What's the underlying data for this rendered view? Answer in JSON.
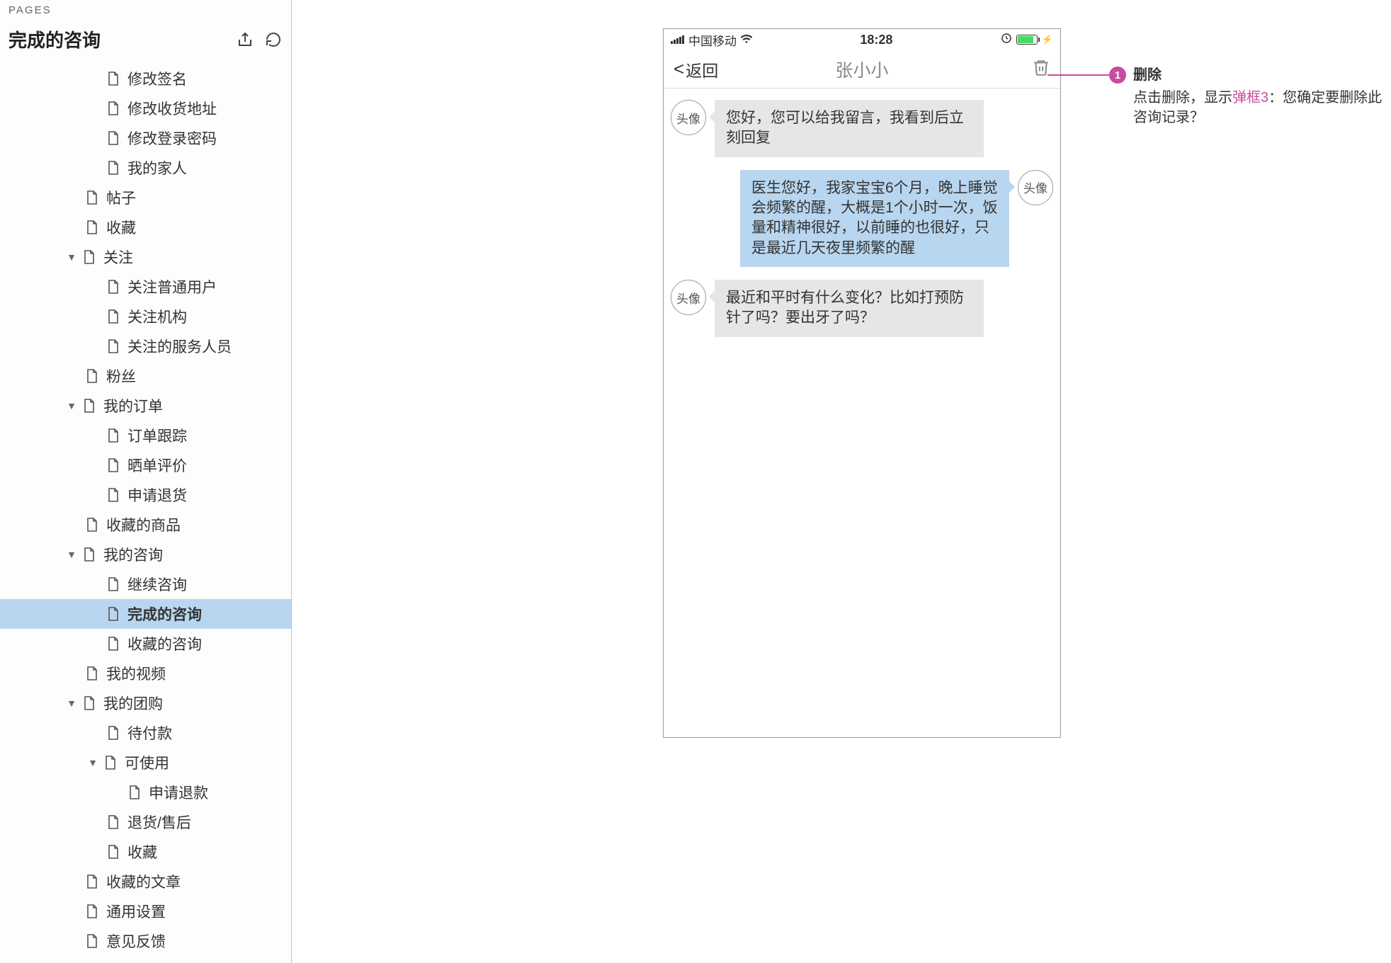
{
  "sidebar": {
    "pages_label": "PAGES",
    "title": "完成的咨询",
    "tree": [
      {
        "label": "修改签名",
        "indent": 3,
        "toggle": null
      },
      {
        "label": "修改收货地址",
        "indent": 3,
        "toggle": null
      },
      {
        "label": "修改登录密码",
        "indent": 3,
        "toggle": null
      },
      {
        "label": "我的家人",
        "indent": 3,
        "toggle": null
      },
      {
        "label": "帖子",
        "indent": 2,
        "toggle": null
      },
      {
        "label": "收藏",
        "indent": 2,
        "toggle": null
      },
      {
        "label": "关注",
        "indent": 2,
        "toggle": "open"
      },
      {
        "label": "关注普通用户",
        "indent": 3,
        "toggle": null
      },
      {
        "label": "关注机构",
        "indent": 3,
        "toggle": null
      },
      {
        "label": "关注的服务人员",
        "indent": 3,
        "toggle": null
      },
      {
        "label": "粉丝",
        "indent": 2,
        "toggle": null
      },
      {
        "label": "我的订单",
        "indent": 2,
        "toggle": "open"
      },
      {
        "label": "订单跟踪",
        "indent": 3,
        "toggle": null
      },
      {
        "label": "晒单评价",
        "indent": 3,
        "toggle": null
      },
      {
        "label": "申请退货",
        "indent": 3,
        "toggle": null
      },
      {
        "label": "收藏的商品",
        "indent": 2,
        "toggle": null
      },
      {
        "label": "我的咨询",
        "indent": 2,
        "toggle": "open"
      },
      {
        "label": "继续咨询",
        "indent": 3,
        "toggle": null
      },
      {
        "label": "完成的咨询",
        "indent": 3,
        "toggle": null,
        "selected": true
      },
      {
        "label": "收藏的咨询",
        "indent": 3,
        "toggle": null
      },
      {
        "label": "我的视频",
        "indent": 2,
        "toggle": null
      },
      {
        "label": "我的团购",
        "indent": 2,
        "toggle": "open"
      },
      {
        "label": "待付款",
        "indent": 3,
        "toggle": null
      },
      {
        "label": "可使用",
        "indent": 3,
        "toggle": "open"
      },
      {
        "label": "申请退款",
        "indent": 4,
        "toggle": null
      },
      {
        "label": "退货/售后",
        "indent": 3,
        "toggle": null
      },
      {
        "label": "收藏",
        "indent": 3,
        "toggle": null
      },
      {
        "label": "收藏的文章",
        "indent": 2,
        "toggle": null
      },
      {
        "label": "通用设置",
        "indent": 2,
        "toggle": null
      },
      {
        "label": "意见反馈",
        "indent": 2,
        "toggle": null
      }
    ]
  },
  "phone": {
    "status": {
      "carrier": "中国移动",
      "time": "18:28"
    },
    "nav": {
      "back": "返回",
      "title": "张小小"
    },
    "avatar_label": "头像",
    "messages": [
      {
        "side": "left",
        "text": "您好，您可以给我留言，我看到后立刻回复"
      },
      {
        "side": "right",
        "text": "医生您好，我家宝宝6个月，晚上睡觉会频繁的醒，大概是1个小时一次，饭量和精神很好，以前睡的也很好，只是最近几天夜里频繁的醒"
      },
      {
        "side": "left",
        "text": "最近和平时有什么变化？比如打预防针了吗？要出牙了吗？"
      }
    ]
  },
  "annotation": {
    "number": "1",
    "title": "删除",
    "desc_prefix": "点击删除，显示",
    "desc_link": "弹框3",
    "desc_suffix": "：您确定要删除此咨询记录？"
  }
}
